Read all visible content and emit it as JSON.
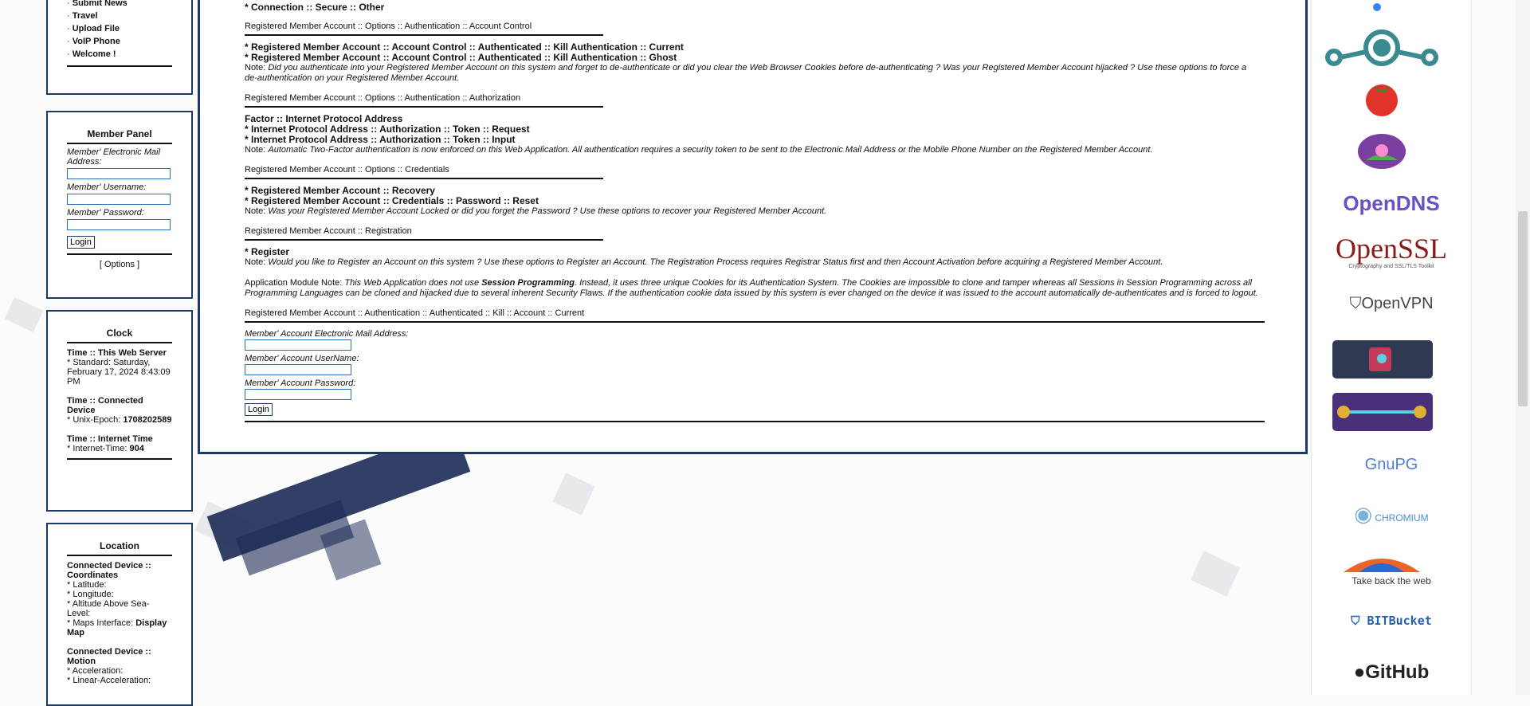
{
  "left": {
    "nav_items": [
      "Submit News",
      "Travel",
      "Upload File",
      "VoIP Phone",
      "Welcome !"
    ],
    "member_panel": {
      "title": "Member Panel",
      "email_label": "Member' Electronic Mail Address:",
      "username_label": "Member' Username:",
      "password_label": "Member' Password:",
      "login_label": "Login",
      "options_label": "[ Options ]"
    },
    "clock": {
      "title": "Clock",
      "server_title": "Time :: This Web Server",
      "server_value": "* Standard: Saturday, February 17, 2024 8:43:09 PM",
      "device_title": "Time :: Connected Device",
      "unix_label": "* Unix-Epoch: ",
      "unix_value": "1708202589",
      "internet_title": "Time :: Internet Time",
      "internet_label": "* Internet-Time: ",
      "internet_value": "904"
    },
    "location": {
      "title": "Location",
      "coords_title": "Connected Device :: Coordinates",
      "latitude": "* Latitude:",
      "longitude": "* Longitude:",
      "altitude": "* Altitude Above Sea-Level:",
      "maps_label": "* Maps Interface: ",
      "maps_value": "Display Map",
      "motion_title": "Connected Device :: Motion",
      "acceleration": "* Acceleration:",
      "linear_acceleration": "* Linear-Acceleration:"
    }
  },
  "main": {
    "top_item": "* Connection :: Secure :: Other",
    "section1_head": "Registered Member Account :: Options :: Authentication :: Account Control",
    "section1_items": [
      "* Registered Member Account :: Account Control :: Authenticated :: Kill Authentication :: Current",
      "* Registered Member Account :: Account Control :: Authenticated :: Kill Authentication :: Ghost"
    ],
    "section1_note_label": "Note: ",
    "section1_note": "Did you authenticate into your Registered Member Account on this system and forget to de-authenticate or did you clear the Web Browser Cookies before de-authenticating ? Was your Registered Member Account hijacked ? Use these options to force a de-authentication on your Registered Member Account.",
    "section2_head": "Registered Member Account :: Options :: Authentication :: Authorization",
    "section2_factor": "Factor :: Internet Protocol Address",
    "section2_items": [
      "* Internet Protocol Address :: Authorization :: Token :: Request",
      "* Internet Protocol Address :: Authorization :: Token :: Input"
    ],
    "section2_note_label": "Note: ",
    "section2_note": "Automatic Two-Factor authentication is now enforced on this Web Application. All authentication requires a security token to be sent to the Electronic Mail Address or the Mobile Phone Number on the Registered Member Account.",
    "section3_head": "Registered Member Account :: Options :: Credentials",
    "section3_items": [
      "* Registered Member Account :: Recovery",
      "* Registered Member Account :: Credentials :: Password :: Reset"
    ],
    "section3_note_label": "Note: ",
    "section3_note": "Was your Registered Member Account Locked or did you forget the Password ? Use these options to recover your Registered Member Account.",
    "section4_head": "Registered Member Account :: Registration",
    "section4_item": "* Register",
    "section4_note_label": "Note: ",
    "section4_note": "Would you like to Register an Account on this system ? Use these options to Register an Account. The Registration Process requires Registrar Status first and then Account Activation before acquiring a Registered Member Account.",
    "module_note_label": "Application Module Note: ",
    "module_note_a": "This Web Application does not use ",
    "module_note_bold": "Session Programming",
    "module_note_b": ". Instead, it uses three unique Cookies for its Authentication System. The Cookies are impossible to clone and tamper whereas all Sessions in Session Programming across all Programming Languages can be cloned and hijacked due to several inherent Security Flaws. If the authentication cookie data issued by this system is ever changed on the device it was issued to the account automatically de-authenticates and is forced to logout.",
    "kill_head": "Registered Member Account :: Authentication :: Authenticated :: Kill :: Account :: Current",
    "form_email": "Member' Account Electronic Mail Address:",
    "form_username": "Member' Account UserName:",
    "form_password": "Member' Account Password:",
    "form_login": "Login"
  },
  "right": {
    "logos": [
      "OpenDNS",
      "OpenSSL",
      "Cryptography and SSL/TLS Toolkit",
      "OpenVPN",
      "GnuPG",
      "CHROMIUM",
      "Take back the web",
      "BITBucket",
      "GitHub"
    ]
  },
  "colors": {
    "panel_border": "#1d3a66",
    "input_border": "#2a6fb5",
    "opendns": "#6a4fc6",
    "openssl": "#8a1a1a"
  }
}
